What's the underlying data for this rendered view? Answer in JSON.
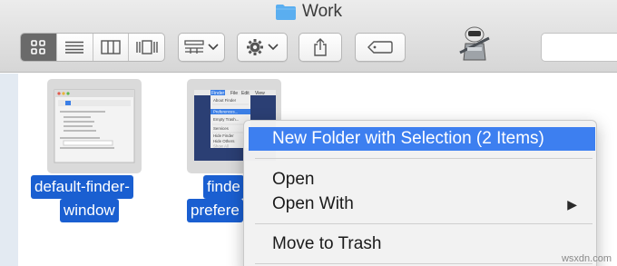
{
  "window": {
    "title": "Work"
  },
  "toolbar": {
    "view_modes": [
      "icon-view",
      "list-view",
      "column-view",
      "cover-flow-view"
    ],
    "arrange_menu": "arrange-menu",
    "action_menu": "action-menu",
    "share": "share",
    "tags": "tags",
    "search_placeholder": ""
  },
  "files": [
    {
      "name_line1": "default-finder-",
      "name_line2": "window"
    },
    {
      "name_line1": "finde",
      "name_line2": "prefere"
    }
  ],
  "context_menu": {
    "items": [
      {
        "label": "New Folder with Selection (2 Items)",
        "highlighted": true
      },
      {
        "label": "Open"
      },
      {
        "label": "Open With",
        "submenu": "▶"
      },
      {
        "label": "Move to Trash"
      }
    ]
  },
  "thumb2_menu": {
    "menubar": [
      "Finder",
      "File",
      "Edit",
      "View"
    ],
    "items": [
      "About Finder",
      "Preferences...",
      "Empty Trash...",
      "Services",
      "Hide Finder",
      "Hide Others",
      "Show All"
    ]
  },
  "watermark": "wsxdn.com",
  "colors": {
    "selection": "#1a5fd1",
    "menu_highlight": "#3d7ff0",
    "folder": "#5aaef0"
  }
}
